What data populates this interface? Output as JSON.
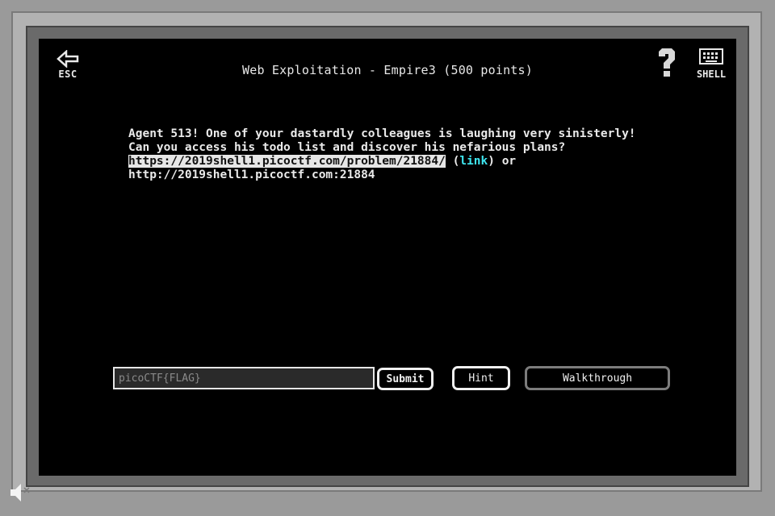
{
  "header": {
    "esc_label": "ESC",
    "title": "Web Exploitation - Empire3 (500 points)",
    "shell_label": "SHELL"
  },
  "description": {
    "line1": "Agent 513! One of your dastardly colleagues is laughing very sinisterly!",
    "line2": "Can you access his todo list and discover his nefarious plans?",
    "url_https": "https://2019shell1.picoctf.com/problem/21884/",
    "paren_open": " (",
    "link_label": "link",
    "paren_close_or": ") or",
    "url_http": "http://2019shell1.picoctf.com:21884"
  },
  "flag_input": {
    "placeholder": "picoCTF{FLAG}",
    "value": ""
  },
  "buttons": {
    "submit": "Submit",
    "hint": "Hint",
    "walkthrough": "Walkthrough"
  },
  "icons": {
    "esc": "back-arrow-icon",
    "help": "question-mark-icon",
    "shell": "keyboard-icon",
    "sound": "speaker-icon"
  },
  "colors": {
    "screen_bg": "#000000",
    "text": "#e8e8e8",
    "link": "#3fe6f0",
    "url_highlight": "#e6e6e6",
    "bezel": "#b2b2b2"
  }
}
